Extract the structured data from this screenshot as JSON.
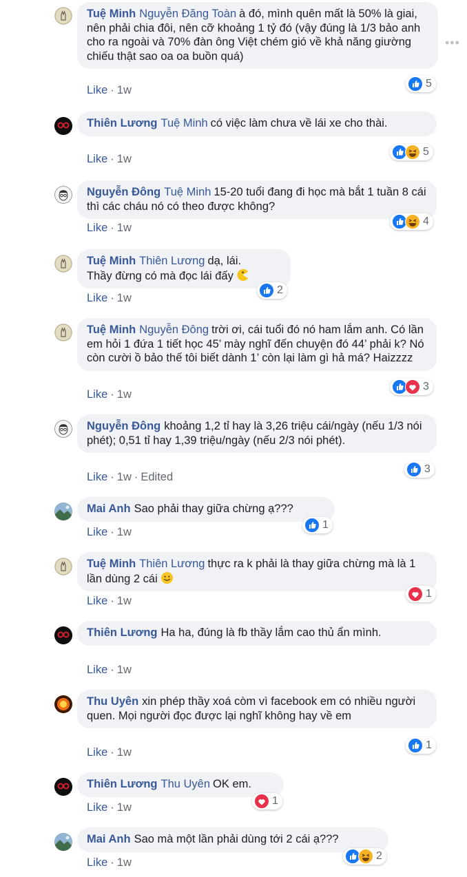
{
  "like_label": "Like",
  "more_icon": "more-options-icon",
  "comments": [
    {
      "author": "Tuệ Minh",
      "mention": "Nguyễn Đăng Toàn",
      "text": "à đó, mình quên mất là 50% là giai, nên phải chia đôi, nên cỡ khoảng 1 tỷ đó (vậy đúng là 1/3 bảo anh cho ra ngoài và 70% đàn ông Việt chém gió về khả năng giường chiếu thật sao oa oa buồn quá)",
      "time": "1w",
      "reactions": [
        "like-icon"
      ],
      "reaction_count": "5",
      "avatar": "hand-avatar"
    },
    {
      "author": "Thiên Lương",
      "mention": "Tuệ Minh",
      "text": "có việc làm chưa về lái xe cho thài.",
      "time": "1w",
      "reactions": [
        "like-icon",
        "haha-icon"
      ],
      "reaction_count": "5",
      "avatar": "red-glasses-avatar"
    },
    {
      "author": "Nguyễn Đông",
      "mention": "Tuệ Minh",
      "text": "15-20 tuổi đang đi học mà bắt 1 tuần 8 cái thì các cháu nó có theo được không?",
      "time": "1w",
      "reactions": [
        "like-icon",
        "haha-icon"
      ],
      "reaction_count": "4",
      "avatar": "sketch-face-avatar"
    },
    {
      "author": "Tuệ Minh",
      "mention": "Thiên Lương",
      "text": "dạ, lái.",
      "text2": "Thầy đừng có mà đọc lái đấy",
      "time": "1w",
      "reactions": [
        "like-icon"
      ],
      "reaction_count": "2",
      "avatar": "hand-avatar",
      "inline_emoji": "pacman-emoji-icon"
    },
    {
      "author": "Tuệ Minh",
      "mention": "Nguyễn Đông",
      "text": "trời ơi, cái tuổi đó nó ham lắm anh. Có lần em hỏi 1 đứa 1 tiết học 45’ mày nghĩ đến chuyện đó 44’ phải k? Nó còn cười ồ bảo thế tôi biết dành 1’ còn lại làm gì hả má? Haizzzz",
      "time": "1w",
      "reactions": [
        "like-icon",
        "love-icon"
      ],
      "reaction_count": "3",
      "avatar": "hand-avatar"
    },
    {
      "author": "Nguyễn Đông",
      "mention": "",
      "text": "khoảng 1,2 tỉ hay là 3,26 triệu cái/ngày (nếu 1/3 nói phét); 0,51 tỉ hay 1,39 triệu/ngày (nếu 2/3 nói phét).",
      "time": "1w",
      "edited": "Edited",
      "reactions": [
        "like-icon"
      ],
      "reaction_count": "3",
      "avatar": "sketch-face-avatar"
    },
    {
      "author": "Mai Anh",
      "mention": "",
      "text": "Sao phải thay giữa chừng ạ???",
      "time": "1w",
      "reactions": [
        "like-icon"
      ],
      "reaction_count": "1",
      "avatar": "landscape-avatar"
    },
    {
      "author": "Tuệ Minh",
      "mention": "Thiên Lương",
      "text": "thực ra k phải là thay giữa chừng mà là 1 lần dùng 2 cái",
      "time": "1w",
      "reactions": [
        "love-icon"
      ],
      "reaction_count": "1",
      "avatar": "hand-avatar",
      "inline_emoji": "smile-emoji-icon"
    },
    {
      "author": "Thiên Lương",
      "mention": "",
      "text": "Ha ha, đúng là fb thầy lắm cao thủ ẩn mình.",
      "time": "1w",
      "reactions": [],
      "reaction_count": "",
      "avatar": "red-glasses-avatar"
    },
    {
      "author": "Thu Uyên",
      "mention": "",
      "text": "xin phép thầy xoá còm vì facebook em có nhiều người quen. Mọi người đọc được lại nghĩ không hay về em",
      "time": "1w",
      "reactions": [
        "like-icon"
      ],
      "reaction_count": "1",
      "avatar": "fire-avatar"
    },
    {
      "author": "Thiên Lương",
      "mention": "Thu Uyên",
      "text": "OK em.",
      "time": "1w",
      "reactions": [
        "love-icon"
      ],
      "reaction_count": "1",
      "avatar": "red-glasses-avatar"
    },
    {
      "author": "Mai Anh",
      "mention": "",
      "text": "Sao mà một lần phải dùng tới 2 cái ạ???",
      "time": "1w",
      "reactions": [
        "like-icon",
        "haha-icon"
      ],
      "reaction_count": "2",
      "avatar": "landscape-avatar"
    }
  ]
}
